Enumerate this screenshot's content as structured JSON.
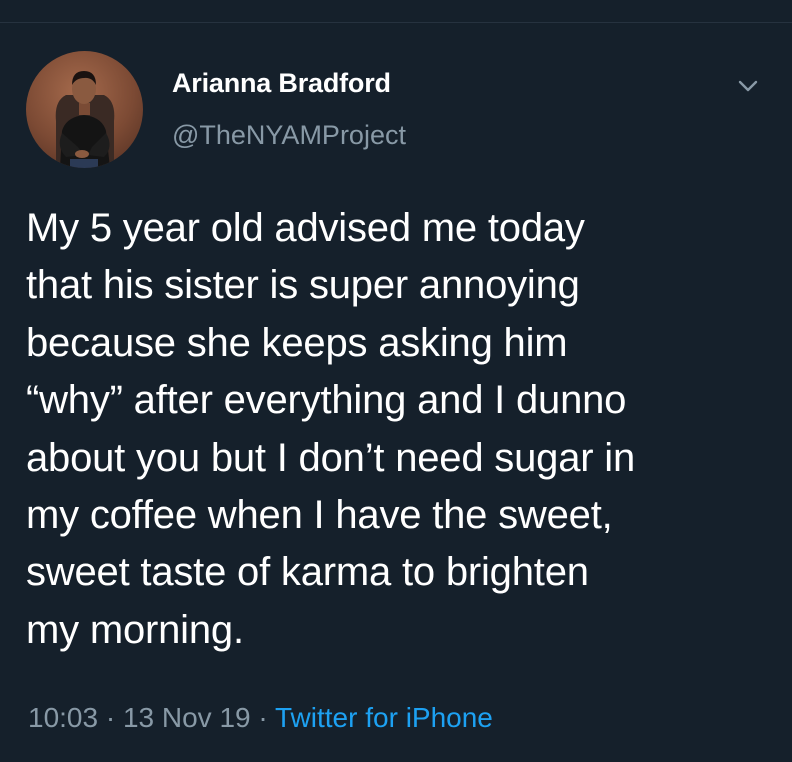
{
  "tweet": {
    "author": {
      "display_name": "Arianna Bradford",
      "handle": "@TheNYAMProject",
      "avatar_icon": "user-photo-avatar"
    },
    "menu_icon": "chevron-down-icon",
    "text": "My 5 year old advised me today\nthat his sister is super annoying\nbecause she keeps asking him\n“why” after everything and I dunno\nabout you but I don’t need sugar in\nmy coffee when I have the sweet,\nsweet taste of karma to brighten\nmy morning.",
    "time": "10:03",
    "separator": " · ",
    "date": "13 Nov 19",
    "source": "Twitter for iPhone"
  },
  "colors": {
    "background": "#15202b",
    "text": "#ffffff",
    "secondary_text": "#8899a6",
    "link": "#1da1f2"
  }
}
